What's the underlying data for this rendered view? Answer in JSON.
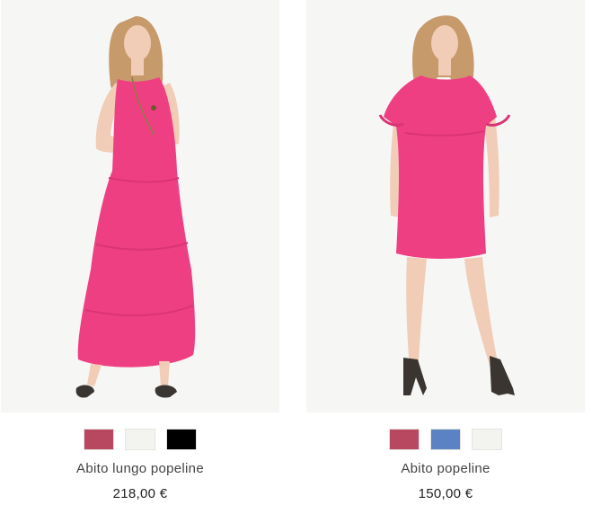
{
  "products": [
    {
      "name": "Abito lungo popeline",
      "price": "218,00 €",
      "dress_color": "#ef3f83",
      "swatches": [
        {
          "color_name": "rose",
          "hex": "#b8485f"
        },
        {
          "color_name": "off-white",
          "hex": "#f3f3ef"
        },
        {
          "color_name": "black",
          "hex": "#000000"
        }
      ]
    },
    {
      "name": "Abito popeline",
      "price": "150,00 €",
      "dress_color": "#ef3f83",
      "swatches": [
        {
          "color_name": "rose",
          "hex": "#b8485f"
        },
        {
          "color_name": "blue",
          "hex": "#5b82c2"
        },
        {
          "color_name": "off-white",
          "hex": "#f3f3ef"
        }
      ]
    }
  ],
  "colors": {
    "image_background": "#f6f6f5",
    "skin": "#f1cdb7",
    "hair": "#c79a6b"
  }
}
